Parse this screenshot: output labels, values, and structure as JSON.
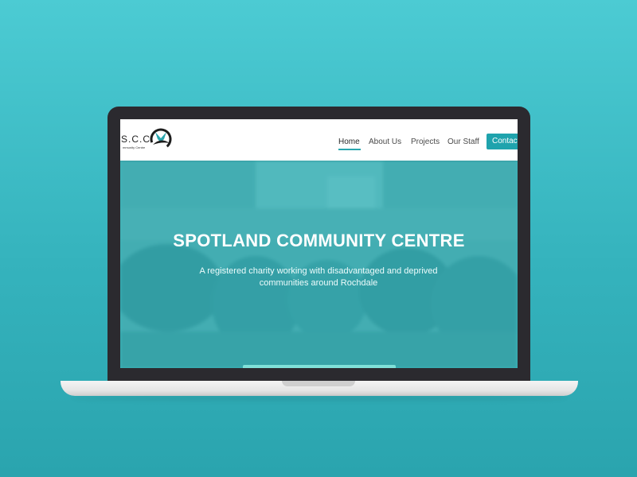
{
  "logo": {
    "text": "S.C.C",
    "subtext": "mmunity Centre"
  },
  "nav": {
    "items": [
      {
        "label": "Home",
        "active": true
      },
      {
        "label": "About Us",
        "active": false
      },
      {
        "label": "Projects",
        "active": false
      },
      {
        "label": "Our Staff",
        "active": false
      }
    ],
    "contact_label": "Contact"
  },
  "hero": {
    "title": "SPOTLAND COMMUNITY CENTRE",
    "subtitle": "A registered charity working with disadvantaged and deprived communities around Rochdale"
  },
  "colors": {
    "accent": "#1fa3ad",
    "background": "#3cbec6",
    "hero_overlay": "#38b6bb"
  }
}
